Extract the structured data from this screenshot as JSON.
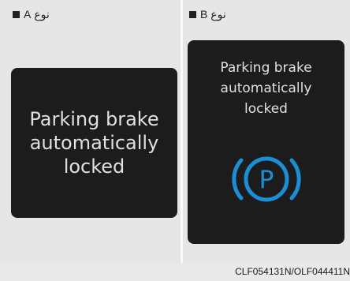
{
  "type_a": {
    "label": "نوع A",
    "message_lines": [
      "Parking brake",
      "automatically",
      "locked"
    ]
  },
  "type_b": {
    "label": "نوع B",
    "message_lines": [
      "Parking brake",
      "automatically",
      "locked"
    ],
    "icon": "parking-brake-icon",
    "icon_letter": "P",
    "icon_color": "#1a8fd6"
  },
  "footer": {
    "code": "CLF054131N/OLF044411N"
  }
}
